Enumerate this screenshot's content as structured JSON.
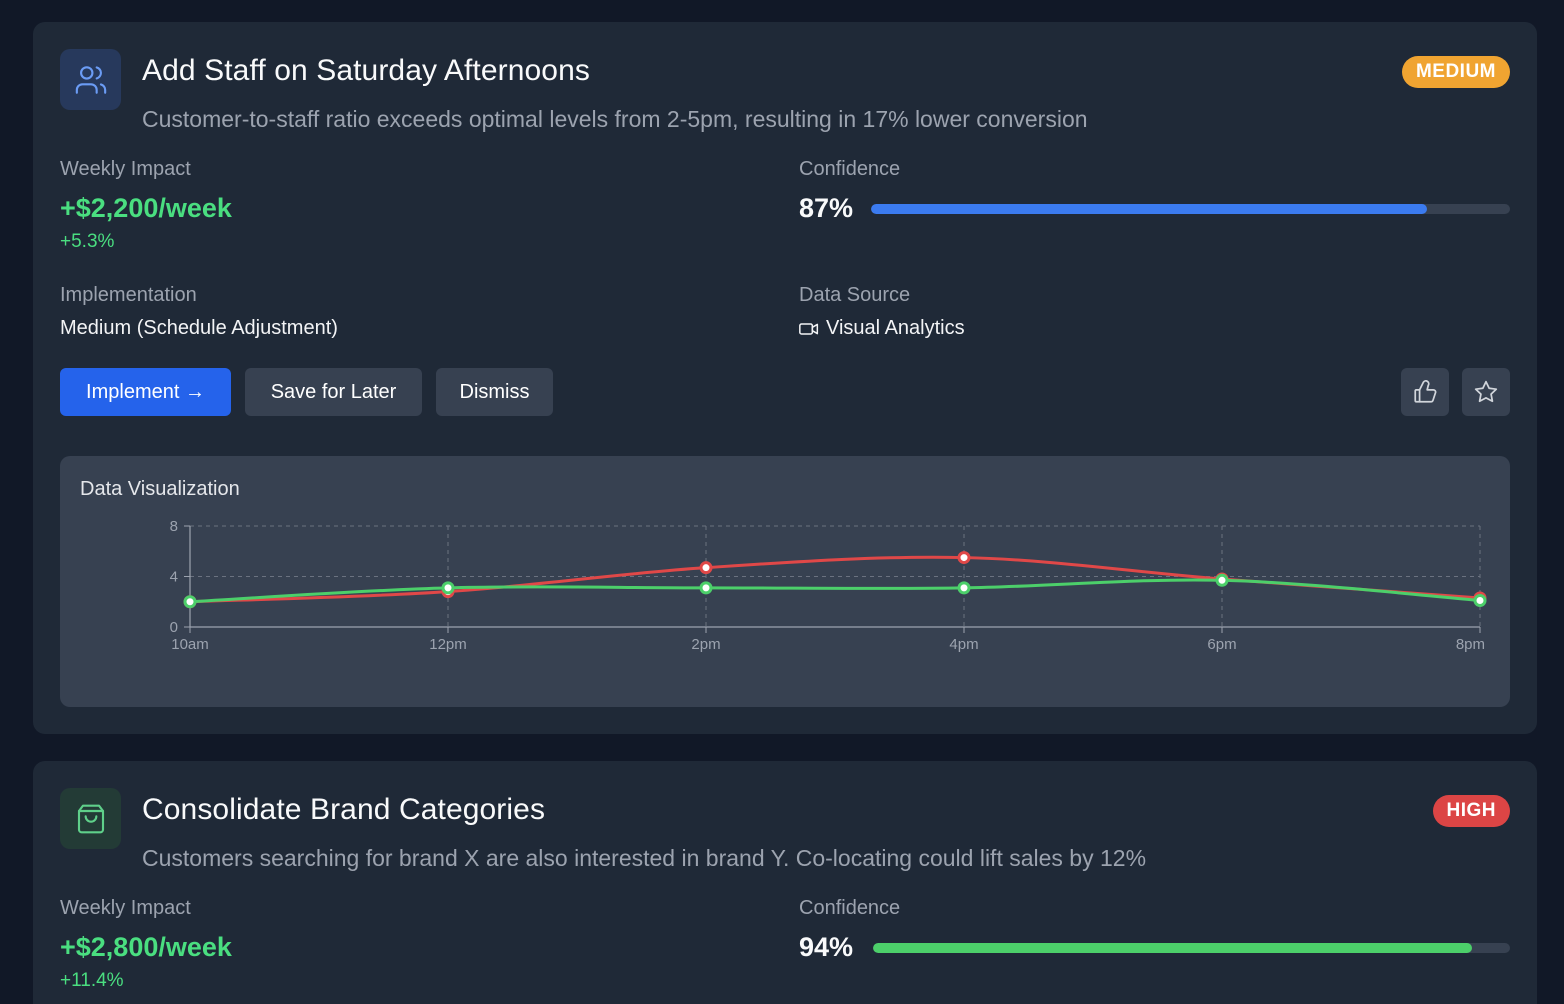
{
  "recommendations": [
    {
      "title": "Add Staff on Saturday Afternoons",
      "icon": "users-icon",
      "priority": "MEDIUM",
      "priority_color": "#f0a431",
      "description": "Customer-to-staff ratio exceeds optimal levels from 2-5pm, resulting in 17% lower conversion",
      "weekly_impact_label": "Weekly Impact",
      "weekly_impact": "+$2,200/week",
      "weekly_impact_pct": "+5.3%",
      "confidence_label": "Confidence",
      "confidence": "87%",
      "confidence_fraction": 0.87,
      "confidence_color": "#3b7bf0",
      "implementation_label": "Implementation",
      "implementation": "Medium (Schedule Adjustment)",
      "data_source_label": "Data Source",
      "data_source": "Visual Analytics",
      "data_source_icon": "video-camera-icon",
      "actions": {
        "implement": "Implement →",
        "save": "Save for Later",
        "dismiss": "Dismiss"
      },
      "visualization_title": "Data Visualization"
    },
    {
      "title": "Consolidate Brand Categories",
      "icon": "shopping-bag-icon",
      "priority": "HIGH",
      "priority_color": "#dc4545",
      "description": "Customers searching for brand X are also interested in brand Y. Co-locating could lift sales by 12%",
      "weekly_impact_label": "Weekly Impact",
      "weekly_impact": "+$2,800/week",
      "weekly_impact_pct": "+11.4%",
      "confidence_label": "Confidence",
      "confidence": "94%",
      "confidence_fraction": 0.94,
      "confidence_color": "#4ccf6a"
    }
  ],
  "chart_data": {
    "type": "line",
    "categories": [
      "10am",
      "12pm",
      "2pm",
      "4pm",
      "6pm",
      "8pm"
    ],
    "ylim": [
      0,
      8
    ],
    "yticks": [
      "0",
      "4",
      "8"
    ],
    "grid": true,
    "series": [
      {
        "color": "#e04848",
        "values": [
          2,
          2.8,
          4.7,
          5.5,
          3.8,
          2.3
        ]
      },
      {
        "color": "#4ccf6a",
        "values": [
          2,
          3.1,
          3.1,
          3.1,
          3.7,
          2.1
        ]
      }
    ]
  }
}
